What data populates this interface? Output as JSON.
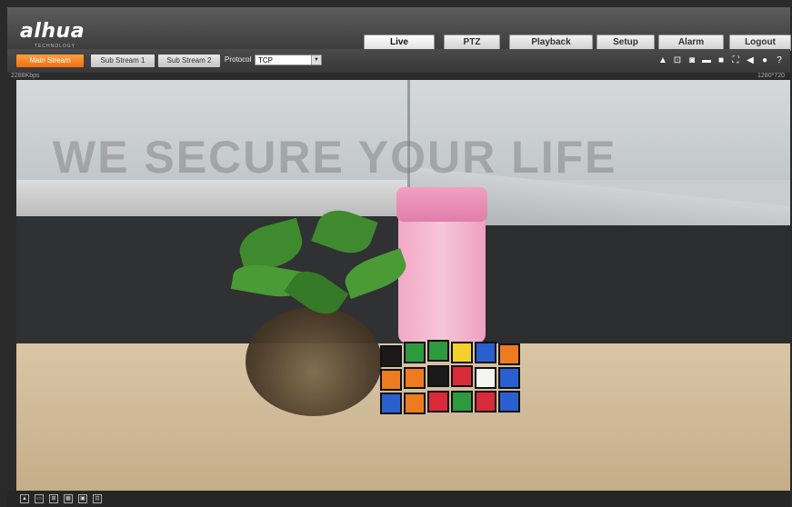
{
  "header": {
    "logo": "alhua",
    "logo_sub": "TECHNOLOGY",
    "tabs": [
      {
        "label": "Live",
        "active": true
      },
      {
        "label": "PTZ",
        "active": false
      },
      {
        "label": "Playback",
        "active": false
      },
      {
        "label": "Setup",
        "active": false
      },
      {
        "label": "Alarm",
        "active": false
      },
      {
        "label": "Logout",
        "active": false
      }
    ]
  },
  "toolbar": {
    "main_stream": "Main Stream",
    "sub_stream_1": "Sub Stream 1",
    "sub_stream_2": "Sub Stream 2",
    "protocol_label": "Protocol",
    "protocol_value": "TCP",
    "tools": [
      "user-icon",
      "zoom-icon",
      "snapshot-icon",
      "record-icon",
      "video-icon",
      "fullscreen-icon",
      "audio-icon",
      "microphone-icon",
      "help-icon"
    ]
  },
  "status": {
    "bitrate": "2288Kbps",
    "resolution": "1280*720"
  },
  "video": {
    "watermark": "WE SECURE YOUR LIFE"
  },
  "bottom_bar": {
    "icons": [
      "original-size-icon",
      "full-scale-icon",
      "fit-icon",
      "ratio-icon",
      "expand-icon",
      "pip-icon"
    ],
    "labels": [
      "",
      "",
      "",
      "",
      "",
      ""
    ]
  },
  "colors": {
    "accent": "#f07a1c",
    "toolbar": "#3e3e3e"
  }
}
